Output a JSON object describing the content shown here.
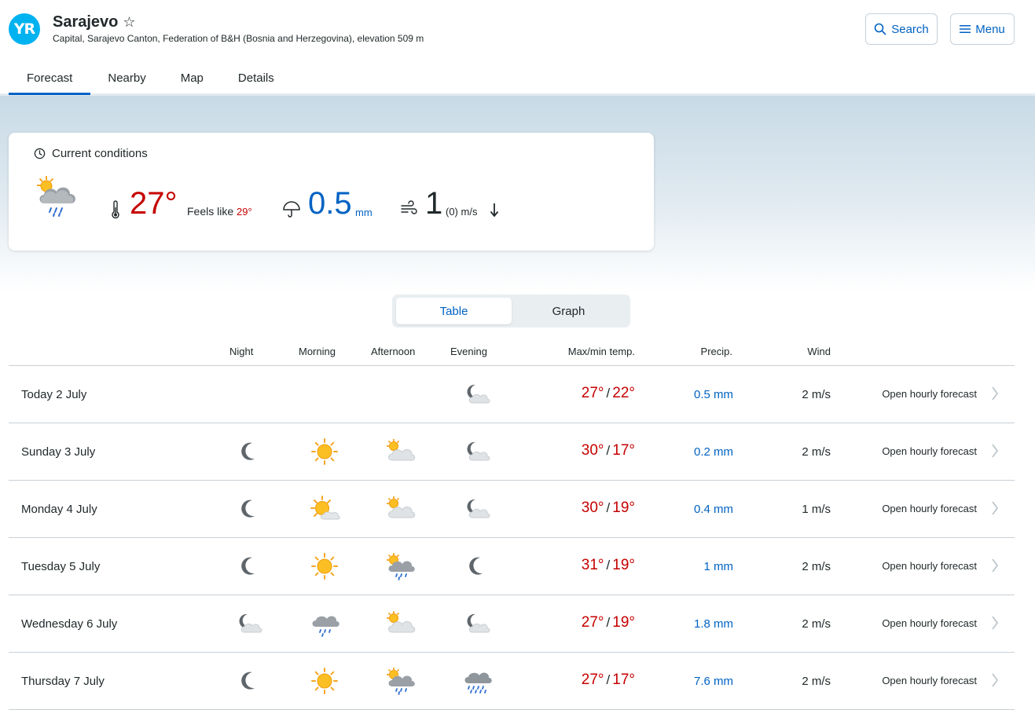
{
  "header": {
    "logo_text": "YR",
    "title": "Sarajevo",
    "subtitle": "Capital, Sarajevo Canton, Federation of B&H (Bosnia and Herzegovina), elevation 509 m",
    "search_label": "Search",
    "menu_label": "Menu"
  },
  "tabs": [
    {
      "label": "Forecast",
      "active": true
    },
    {
      "label": "Nearby",
      "active": false
    },
    {
      "label": "Map",
      "active": false
    },
    {
      "label": "Details",
      "active": false
    }
  ],
  "current": {
    "heading": "Current conditions",
    "icon": "partly-cloudy-rain-icon",
    "temp": "27°",
    "feels_label": "Feels like ",
    "feels_value": "29°",
    "precip": "0.5",
    "precip_unit": "mm",
    "wind": "1",
    "gust": "(0) m/s"
  },
  "view_toggle": {
    "table": "Table",
    "graph": "Graph",
    "selected": "Table"
  },
  "columns": {
    "night": "Night",
    "morning": "Morning",
    "afternoon": "Afternoon",
    "evening": "Evening",
    "temp": "Max/min temp.",
    "precip": "Precip.",
    "wind": "Wind"
  },
  "rows": [
    {
      "day": "Today 2 July",
      "symbols": [
        "",
        "",
        "",
        "moon-cloud"
      ],
      "max": "27°",
      "min": "22°",
      "precip": "0.5 mm",
      "wind": "2 m/s",
      "link": "Open hourly forecast"
    },
    {
      "day": "Sunday 3 July",
      "symbols": [
        "moon",
        "sun",
        "sun-cloud",
        "moon-cloud"
      ],
      "max": "30°",
      "min": "17°",
      "precip": "0.2 mm",
      "wind": "2 m/s",
      "link": "Open hourly forecast"
    },
    {
      "day": "Monday 4 July",
      "symbols": [
        "moon",
        "sun-small-cloud",
        "sun-cloud",
        "moon-cloud"
      ],
      "max": "30°",
      "min": "19°",
      "precip": "0.4 mm",
      "wind": "1 m/s",
      "link": "Open hourly forecast"
    },
    {
      "day": "Tuesday 5 July",
      "symbols": [
        "moon",
        "sun",
        "sun-cloud-rain",
        "moon"
      ],
      "max": "31°",
      "min": "19°",
      "precip": "1 mm",
      "wind": "2 m/s",
      "link": "Open hourly forecast"
    },
    {
      "day": "Wednesday 6 July",
      "symbols": [
        "moon-cloud",
        "cloud-rain",
        "sun-cloud",
        "moon-cloud"
      ],
      "max": "27°",
      "min": "19°",
      "precip": "1.8 mm",
      "wind": "2 m/s",
      "link": "Open hourly forecast"
    },
    {
      "day": "Thursday 7 July",
      "symbols": [
        "moon",
        "sun",
        "sun-cloud-rain",
        "cloud-heavy-rain"
      ],
      "max": "27°",
      "min": "17°",
      "precip": "7.6 mm",
      "wind": "2 m/s",
      "link": "Open hourly forecast"
    }
  ],
  "colors": {
    "accent": "#0062c3",
    "temp": "#c60000",
    "logo": "#00b2f0"
  }
}
